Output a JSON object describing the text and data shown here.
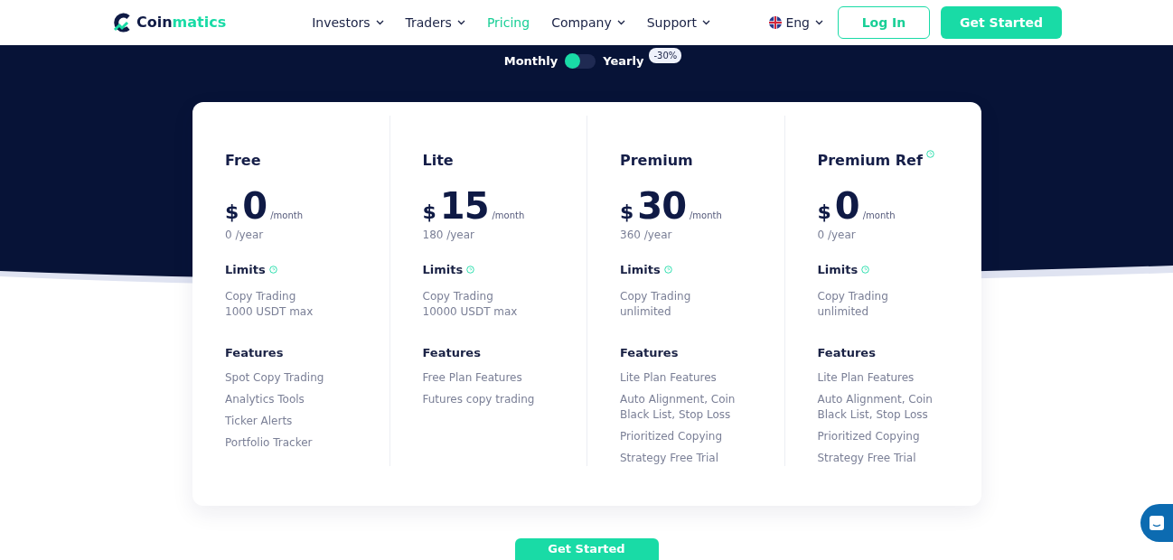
{
  "brand": {
    "name_part1": "Coin",
    "name_part2": "matics"
  },
  "nav": [
    {
      "label": "Investors",
      "dropdown": true,
      "selected": false
    },
    {
      "label": "Traders",
      "dropdown": true,
      "selected": false
    },
    {
      "label": "Pricing",
      "dropdown": false,
      "selected": true
    },
    {
      "label": "Company",
      "dropdown": true,
      "selected": false
    },
    {
      "label": "Support",
      "dropdown": true,
      "selected": false
    }
  ],
  "language": "Eng",
  "login": "Log In",
  "get_started": "Get Started",
  "billing": {
    "monthly": "Monthly",
    "yearly": "Yearly",
    "yearly_on": false,
    "discount": "-30%"
  },
  "plans": [
    {
      "name": "Free",
      "info": false,
      "currency": "$",
      "price": "0",
      "per": "/month",
      "yearly": "0 /year",
      "limits_title": "Limits",
      "limits": [
        "Copy Trading",
        "1000 USDT max"
      ],
      "features_title": "Features",
      "features": [
        "Spot Copy Trading",
        "Analytics Tools",
        "Ticker Alerts",
        "Portfolio Tracker"
      ]
    },
    {
      "name": "Lite",
      "info": false,
      "currency": "$",
      "price": "15",
      "per": "/month",
      "yearly": "180 /year",
      "limits_title": "Limits",
      "limits": [
        "Copy Trading",
        "10000 USDT max"
      ],
      "features_title": "Features",
      "features": [
        "Free Plan Features",
        "Futures copy trading"
      ]
    },
    {
      "name": "Premium",
      "info": false,
      "currency": "$",
      "price": "30",
      "per": "/month",
      "yearly": "360 /year",
      "limits_title": "Limits",
      "limits": [
        "Copy Trading",
        "unlimited"
      ],
      "features_title": "Features",
      "features": [
        "Lite Plan Features",
        "Auto Alignment, Coin Black List, Stop Loss",
        "Prioritized Copying",
        "Strategy Free Trial"
      ]
    },
    {
      "name": "Premium Ref",
      "info": true,
      "currency": "$",
      "price": "0",
      "per": "/month",
      "yearly": "0 /year",
      "limits_title": "Limits",
      "limits": [
        "Copy Trading",
        "unlimited"
      ],
      "features_title": "Features",
      "features": [
        "Lite Plan Features",
        "Auto Alignment, Coin Black List, Stop Loss",
        "Prioritized Copying",
        "Strategy Free Trial"
      ]
    }
  ],
  "bottom_button": "Get Started"
}
